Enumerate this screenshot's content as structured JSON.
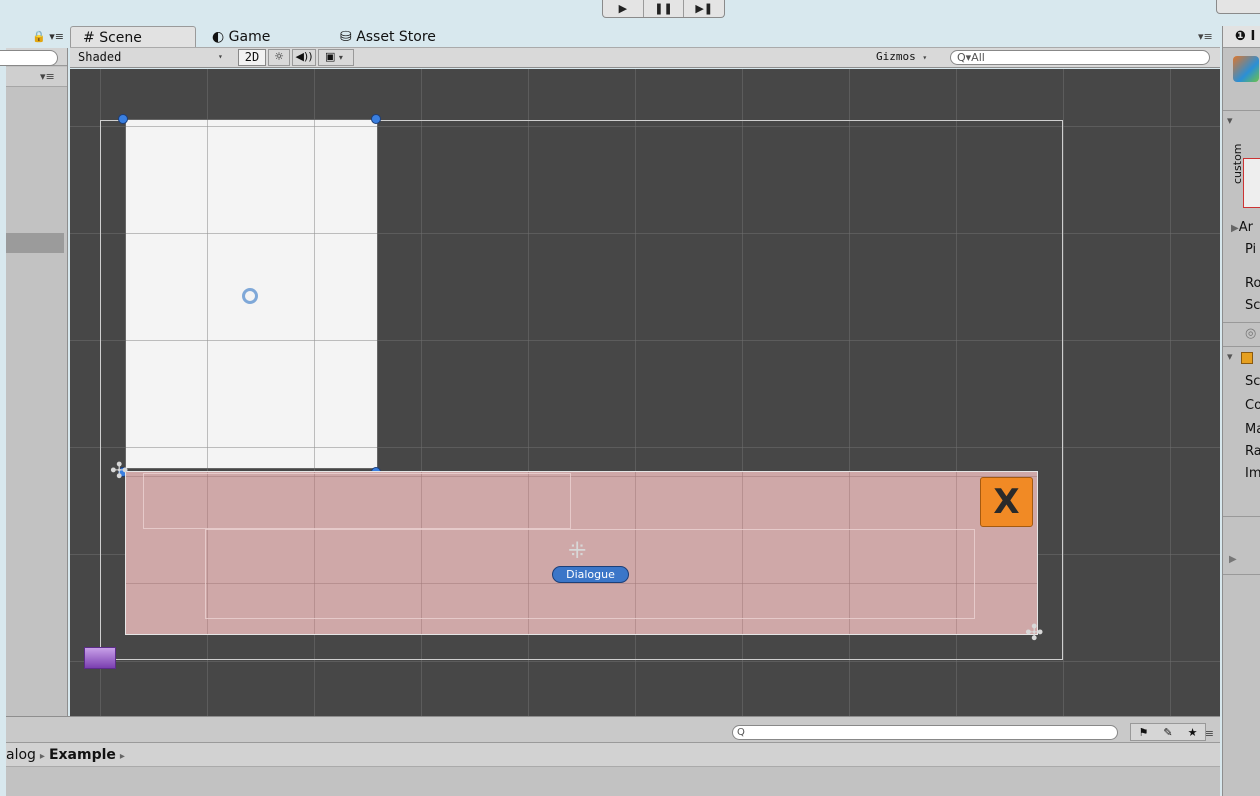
{
  "play_controls": {
    "play": "▶",
    "pause": "❚❚",
    "step": "▶❚"
  },
  "tabs": [
    {
      "icon": "#",
      "label": "Scene"
    },
    {
      "icon": "◐",
      "label": "Game"
    },
    {
      "icon": "⛁",
      "label": "Asset Store"
    }
  ],
  "tab_menu": "▾≡",
  "left_panel": {
    "header_icons": "🔒 ▾≡",
    "sub_menu": "▾≡"
  },
  "scene_toolbar": {
    "shading_mode": "Shaded",
    "mode_2d": "2D",
    "lighting_icon": "☼",
    "audio_icon": "◀))",
    "image_icon": "▣",
    "gizmos": "Gizmos",
    "search_placeholder": "Q▾All"
  },
  "scene": {
    "close_button_label": "X",
    "dialogue_label": "Dialogue"
  },
  "inspector": {
    "tab_icon": "❶",
    "tab_label": "I",
    "rows": [
      "custom",
      "Ar",
      "Pi",
      "Ro",
      "Sc",
      "Sc",
      "Co",
      "Ma",
      "Ra",
      "Im"
    ]
  },
  "bottom_panel": {
    "search_placeholder": "Q",
    "lock_menu": "🔒 ▾≡",
    "breadcrumb": {
      "parent": "alog",
      "current": "Example"
    }
  },
  "colors": {
    "scene_bg": "#474747",
    "pink_panel": "#cfa8a8",
    "close_button": "#f18a25",
    "selection_handle": "#3a7fe0",
    "dialogue_badge": "#3b76c8"
  }
}
